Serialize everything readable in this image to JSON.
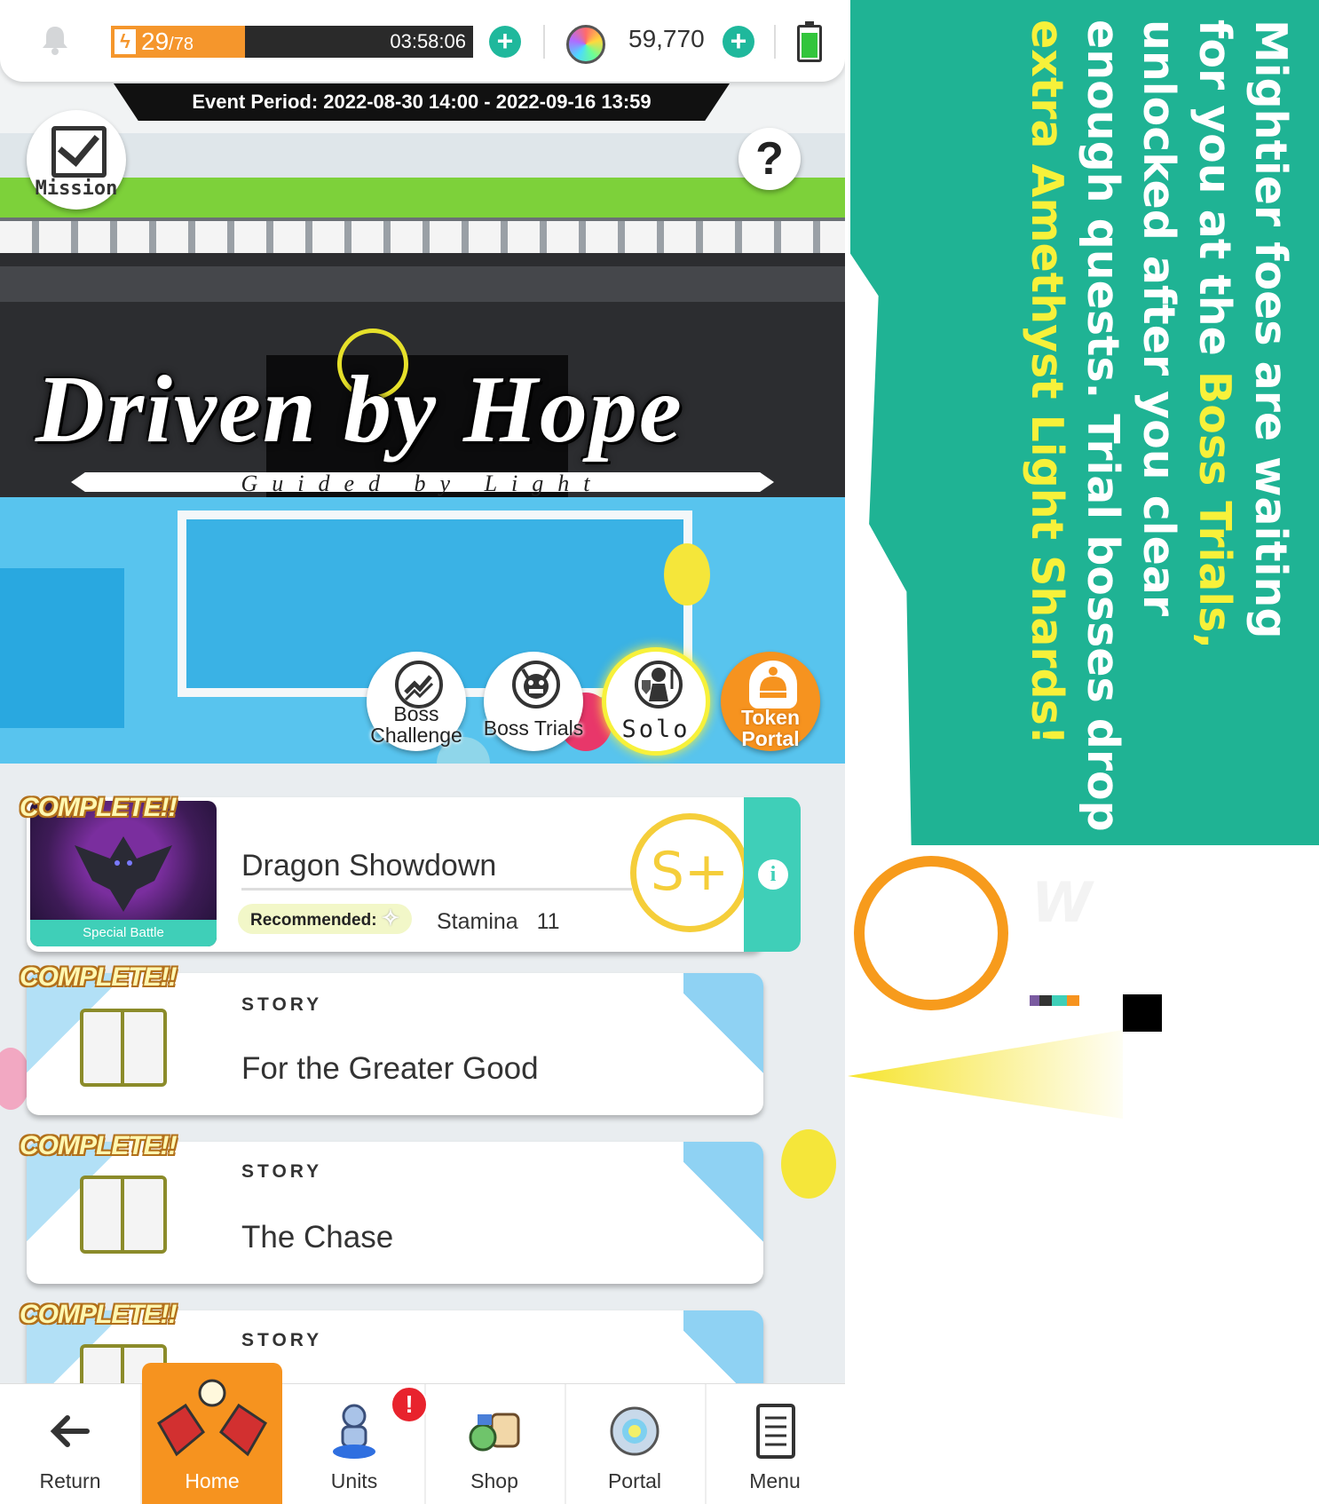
{
  "status_bar": {
    "stamina_current": "29",
    "stamina_max": "/78",
    "stamina_fraction": 0.37,
    "timer": "03:58:06",
    "gems": "59,770"
  },
  "event": {
    "period": "Event Period: 2022-08-30 14:00 - 2022-09-16 13:59"
  },
  "mission": {
    "label": "Mission"
  },
  "help": {
    "label": "?"
  },
  "title": {
    "main": "Driven by Hope",
    "sub": "Guided by Light"
  },
  "modes": [
    {
      "label": "Boss Challenge",
      "icon": "chart-up-icon"
    },
    {
      "label": "Boss Trials",
      "icon": "demon-face-icon"
    },
    {
      "label": "Solo",
      "icon": "solo-fighter-icon"
    },
    {
      "label": "Token Portal",
      "icon": "token-bag-icon"
    }
  ],
  "quests": {
    "complete_label": "COMPLETE!!",
    "dragon": {
      "name": "Dragon Showdown",
      "tag": "Special Battle",
      "recommended": "Recommended:",
      "stamina": "Stamina",
      "stamina_cost": "11",
      "rank": "S+"
    },
    "stories": [
      {
        "tag": "STORY",
        "name": "For the Greater Good"
      },
      {
        "tag": "STORY",
        "name": "The Chase"
      },
      {
        "tag": "STORY",
        "name": ""
      }
    ]
  },
  "nav": [
    {
      "label": "Return",
      "icon": "arrow-left-icon"
    },
    {
      "label": "Home",
      "icon": "home-icon"
    },
    {
      "label": "Units",
      "icon": "units-icon"
    },
    {
      "label": "Shop",
      "icon": "shop-icon"
    },
    {
      "label": "Portal",
      "icon": "portal-icon"
    },
    {
      "label": "Menu",
      "icon": "menu-icon"
    }
  ],
  "nav_badge": "!",
  "promo": {
    "line1": "Mightier foes are waiting",
    "line2a": "for you at the ",
    "line2b": "Boss Trials,",
    "line3": "unlocked after you clear",
    "line4": "enough quests. Trial bosses drop",
    "line5": "extra Amethyst Light Shards!"
  },
  "colors": {
    "accent_teal": "#1fb394",
    "accent_orange": "#f6931f",
    "highlight_yellow": "#f7f13a"
  }
}
